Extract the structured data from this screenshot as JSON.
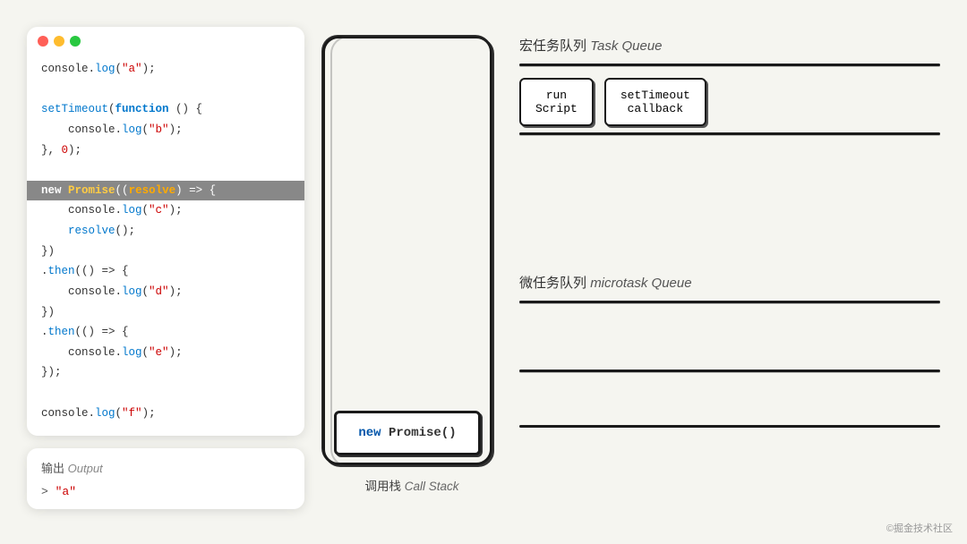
{
  "window": {
    "dots": [
      "red",
      "yellow",
      "green"
    ]
  },
  "code": {
    "lines": [
      {
        "text": "console.log(\"a\");",
        "type": "normal",
        "parts": [
          {
            "t": "plain",
            "v": "console."
          },
          {
            "t": "fn",
            "v": "log"
          },
          {
            "t": "plain",
            "v": "("
          },
          {
            "t": "str",
            "v": "\"a\""
          },
          {
            "t": "plain",
            "v": ");"
          }
        ]
      },
      {
        "text": "",
        "type": "blank"
      },
      {
        "text": "setTimeout(function () {",
        "type": "normal"
      },
      {
        "text": "    console.log(\"b\");",
        "type": "normal"
      },
      {
        "text": "}, 0);",
        "type": "normal"
      },
      {
        "text": "",
        "type": "blank"
      },
      {
        "text": "new Promise((resolve) => {",
        "type": "highlighted"
      },
      {
        "text": "    console.log(\"c\");",
        "type": "normal"
      },
      {
        "text": "    resolve();",
        "type": "normal"
      },
      {
        "text": "})",
        "type": "normal"
      },
      {
        "text": ".then(() => {",
        "type": "normal"
      },
      {
        "text": "    console.log(\"d\");",
        "type": "normal"
      },
      {
        "text": "})",
        "type": "normal"
      },
      {
        "text": ".then(() => {",
        "type": "normal"
      },
      {
        "text": "    console.log(\"e\");",
        "type": "normal"
      },
      {
        "text": "});",
        "type": "normal"
      },
      {
        "text": "",
        "type": "blank"
      },
      {
        "text": "console.log(\"f\");",
        "type": "normal"
      }
    ]
  },
  "output": {
    "label": "输出",
    "label_en": "Output",
    "content": "> \"a\""
  },
  "call_stack": {
    "label": "调用栈",
    "label_en": "Call Stack",
    "current_item": "new Promise()"
  },
  "task_queue": {
    "title": "宏任务队列",
    "title_en": "Task Queue",
    "items": [
      {
        "line1": "run",
        "line2": "Script"
      },
      {
        "line1": "setTimeout",
        "line2": "callback"
      }
    ]
  },
  "microtask_queue": {
    "title": "微任务队列",
    "title_en": "microtask Queue",
    "items": []
  },
  "watermark": "©掘金技术社区"
}
